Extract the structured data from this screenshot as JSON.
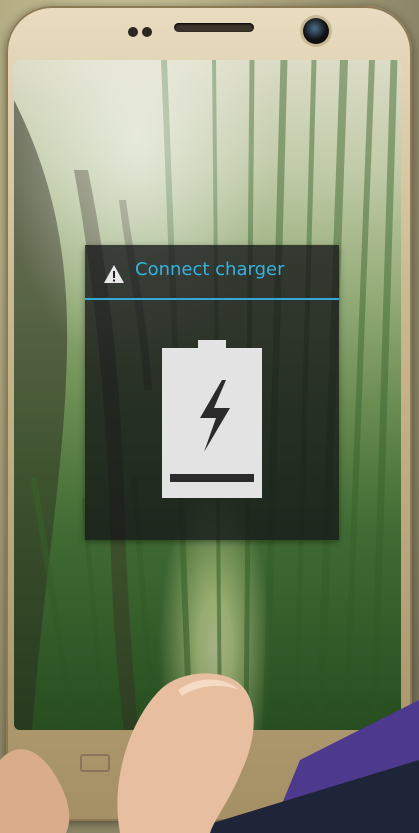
{
  "dialog": {
    "title": "Connect charger",
    "icon": "warning-icon",
    "battery_icon": "battery-charging-icon",
    "accent_color": "#35b3e0"
  },
  "device": {
    "navigation_icons": [
      "recent-apps-icon",
      "back-icon"
    ]
  }
}
